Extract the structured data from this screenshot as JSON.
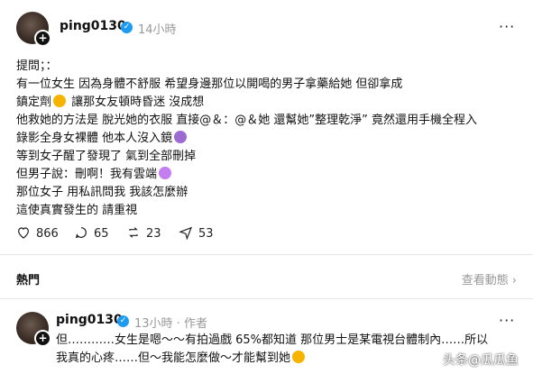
{
  "post": {
    "username": "ping0130",
    "time": "14小時",
    "lines": [
      "提問；：",
      "有一位女生 因為身體不舒服 希望身邊那位以開喝的男子拿藥給她 但卻拿成",
      "鎮定劑",
      "讓那女友頓時昏迷 沒成想",
      "他救她的方法是 脫光她的衣服 直接@＆：@＆她 還幫她”整理乾淨” 竟然還用手機全程入",
      "錄影全身女裸體 他本人沒入鏡",
      "等到女子醒了發現了 氣到全部刪掉",
      "但男子說：刪啊！我有雲端",
      "那位女子 用私訊問我 我該怎麼辦",
      "這使真實發生的 請重視"
    ],
    "stats": {
      "likes": "866",
      "comments": "65",
      "reposts": "23",
      "shares": "53"
    }
  },
  "section": {
    "title": "熱門",
    "view_activity": "查看動態"
  },
  "reply": {
    "username": "ping0130",
    "time": "13小時",
    "role": "作者",
    "lines": [
      "但…………女生是嗯～～有拍過戲 65%都知道 那位男士是某電視台體制內……所以",
      "我真的心疼……但～我能怎麼做～才能幫到她"
    ]
  },
  "watermark": "头条@瓜瓜鱼",
  "icons": [
    "plus-icon",
    "verified-icon",
    "more-icon",
    "heart-icon",
    "comment-icon",
    "repost-icon",
    "share-icon",
    "chevron-right-icon"
  ]
}
